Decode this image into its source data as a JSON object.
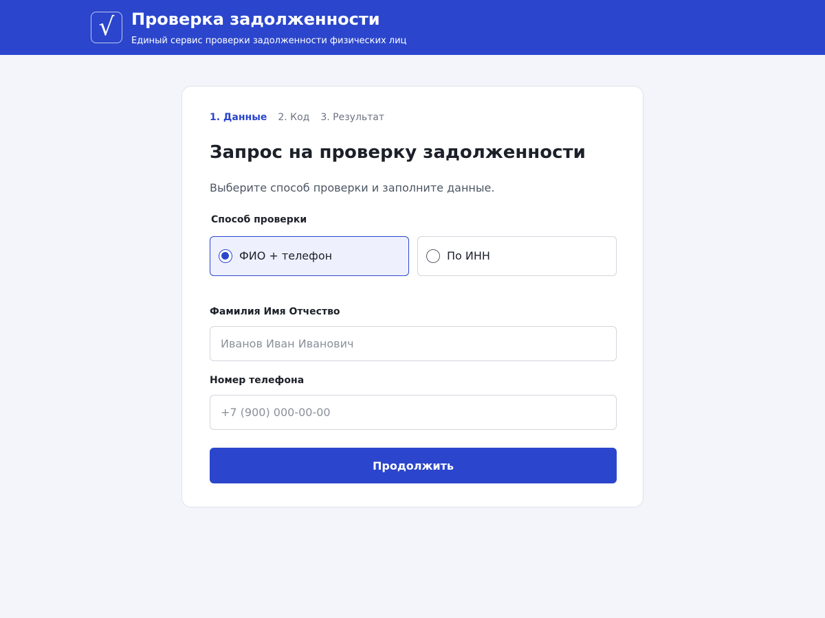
{
  "header": {
    "logo_icon": "checkmark-icon",
    "logo_glyph": "√",
    "title": "Проверка задолженности",
    "subtitle": "Единый сервис проверки задолженности физических лиц",
    "background_color": "#2b46cc"
  },
  "steps": [
    {
      "label": "1. Данные",
      "active": true
    },
    {
      "label": "2. Код",
      "active": false
    },
    {
      "label": "3. Результат",
      "active": false
    }
  ],
  "form": {
    "title": "Запрос на проверку задолженности",
    "description": "Выберите способ проверки и заполните данные.",
    "method_label": "Способ проверки",
    "methods": [
      {
        "label": "ФИО + телефон",
        "selected": true
      },
      {
        "label": "По ИНН",
        "selected": false
      }
    ],
    "name_field": {
      "label": "Фамилия Имя Отчество",
      "value": "",
      "placeholder": "Иванов Иван Иванович"
    },
    "phone_field": {
      "label": "Номер телефона",
      "value": "",
      "placeholder": "+7 (900) 000-00-00"
    },
    "submit_label": "Продолжить"
  },
  "colors": {
    "accent": "#2b46cc",
    "page_background": "#f3f5fa",
    "selected_option_background": "#eef1fd"
  }
}
